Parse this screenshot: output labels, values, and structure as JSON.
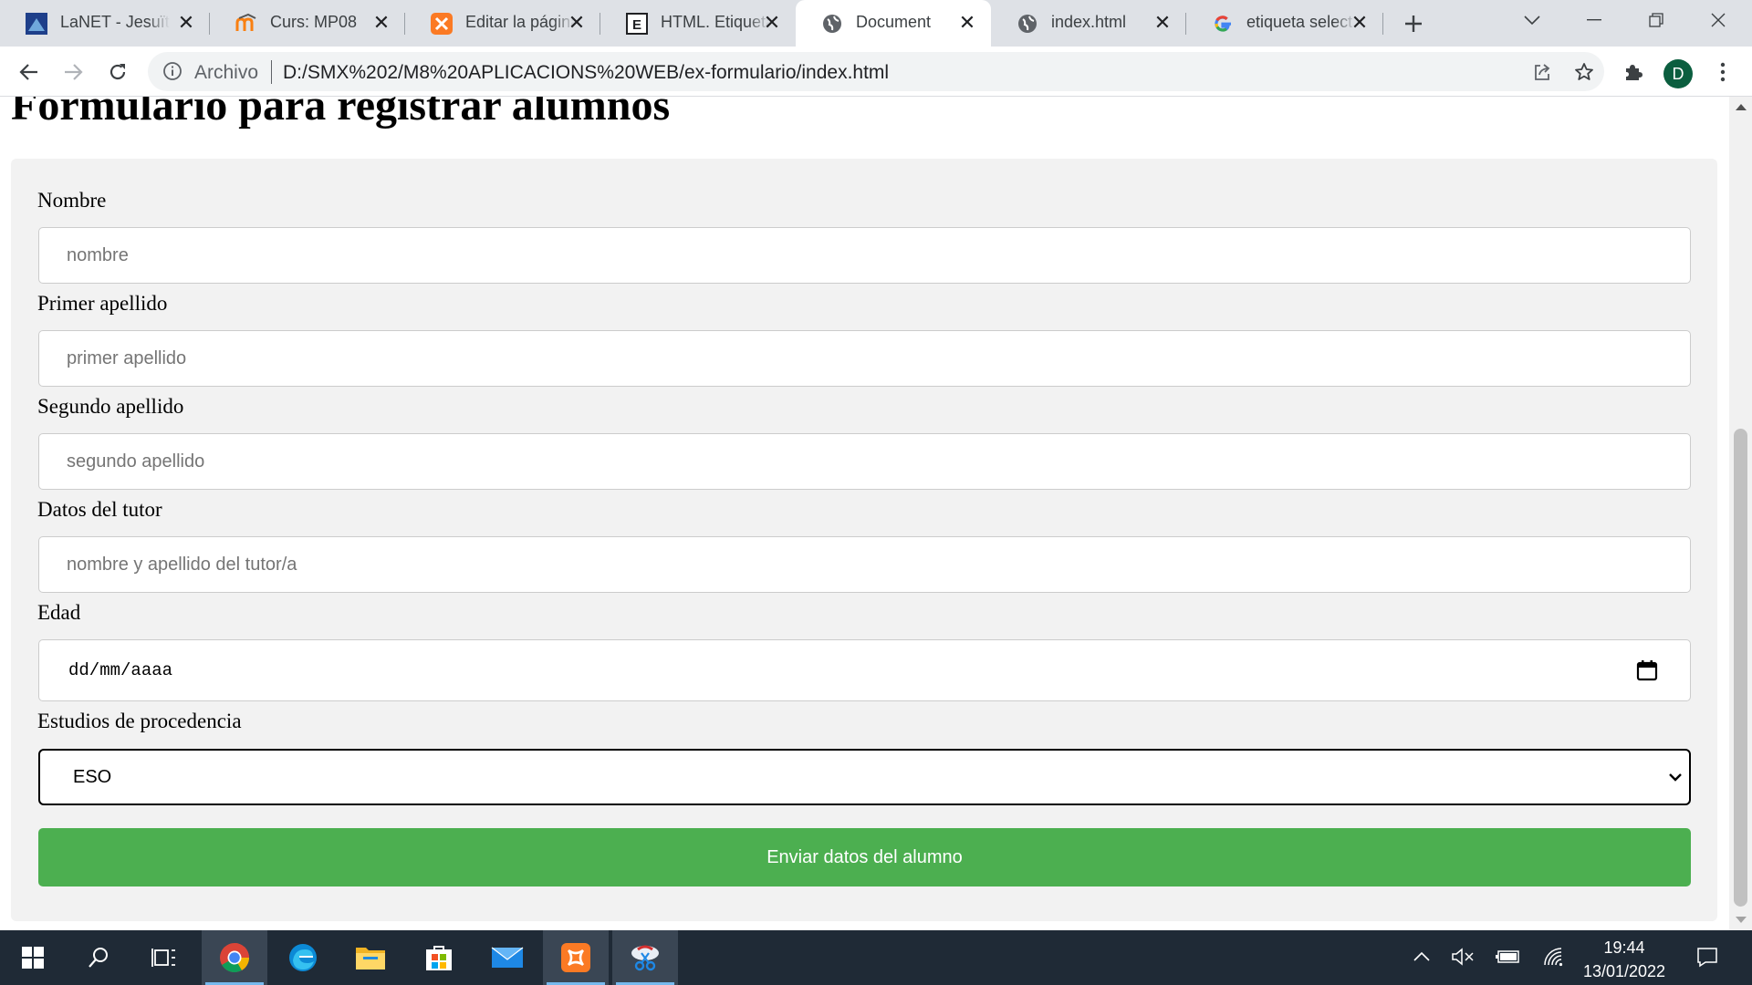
{
  "browser": {
    "tabs": [
      {
        "title": "LaNET - Jesuïtes",
        "icon": "lanet-favicon",
        "active": false
      },
      {
        "title": "Curs: MP08",
        "icon": "moodle-favicon",
        "active": false
      },
      {
        "title": "Editar la página",
        "icon": "xampp-favicon",
        "active": false
      },
      {
        "title": "HTML. Etiquetas",
        "icon": "e-favicon",
        "active": false
      },
      {
        "title": "Document",
        "icon": "globe-icon",
        "active": true
      },
      {
        "title": "index.html",
        "icon": "globe-icon",
        "active": false
      },
      {
        "title": "etiqueta select",
        "icon": "google-favicon",
        "active": false
      }
    ],
    "address": {
      "scheme_label": "Archivo",
      "url": "D:/SMX%202/M8%20APLICACIONS%20WEB/ex-formulario/index.html"
    },
    "profile_initial": "D"
  },
  "page": {
    "title": "Formulario para registrar alumnos",
    "form": {
      "fields": {
        "nombre": {
          "label": "Nombre",
          "placeholder": "nombre"
        },
        "primer_apellido": {
          "label": "Primer apellido",
          "placeholder": "primer apellido"
        },
        "segundo_apellido": {
          "label": "Segundo apellido",
          "placeholder": "segundo apellido"
        },
        "tutor": {
          "label": "Datos del tutor",
          "placeholder": "nombre y apellido del tutor/a"
        },
        "edad": {
          "label": "Edad",
          "date_placeholder": "dd/mm/aaaa"
        },
        "estudios": {
          "label": "Estudios de procedencia",
          "selected": "ESO"
        }
      },
      "submit_label": "Enviar datos del alumno"
    }
  },
  "taskbar": {
    "apps": [
      "windows-start",
      "search",
      "task-view",
      "chrome",
      "edge",
      "file-explorer",
      "microsoft-store",
      "mail",
      "xampp",
      "snipping-tool"
    ],
    "time": "19:44",
    "date": "13/01/2022"
  },
  "colors": {
    "submit_green": "#4caf50",
    "form_background": "#f2f2f2",
    "taskbar": "#1f2a36"
  }
}
